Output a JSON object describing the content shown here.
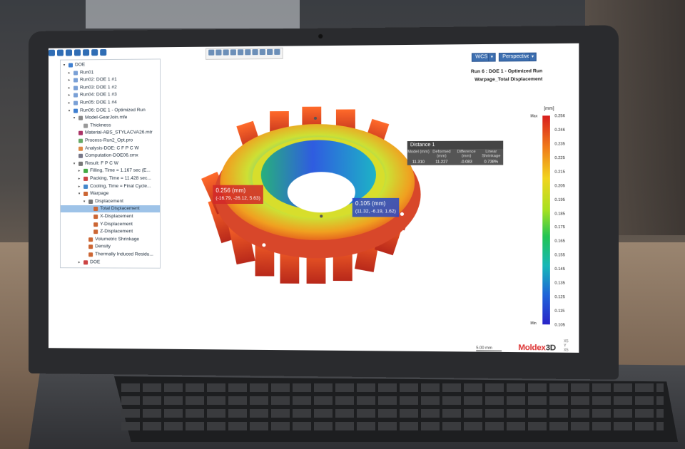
{
  "tree": {
    "nodes": [
      {
        "label": "DOE",
        "indent": 0,
        "toggle": "▾",
        "color": "#3f7fd0"
      },
      {
        "label": "Run01",
        "indent": 1,
        "toggle": "▸",
        "color": "#7aa0d6"
      },
      {
        "label": "Run02: DOE 1 #1",
        "indent": 1,
        "toggle": "▸",
        "color": "#7aa0d6"
      },
      {
        "label": "Run03: DOE 1 #2",
        "indent": 1,
        "toggle": "▸",
        "color": "#7aa0d6"
      },
      {
        "label": "Run04: DOE 1 #3",
        "indent": 1,
        "toggle": "▸",
        "color": "#7aa0d6"
      },
      {
        "label": "Run05: DOE 1 #4",
        "indent": 1,
        "toggle": "▸",
        "color": "#7aa0d6"
      },
      {
        "label": "Run06: DOE 1 - Optimized Run",
        "indent": 1,
        "toggle": "▾",
        "color": "#3f7fd0"
      },
      {
        "label": "Model-GearJoin.mfe",
        "indent": 2,
        "toggle": "▾",
        "color": "#888"
      },
      {
        "label": "Thickness",
        "indent": 3,
        "toggle": "",
        "color": "#999"
      },
      {
        "label": "Material-ABS_STYLACVA26.mtr",
        "indent": 2,
        "toggle": "",
        "color": "#a36"
      },
      {
        "label": "Process-Run2_Opt.pro",
        "indent": 2,
        "toggle": "",
        "color": "#6a6"
      },
      {
        "label": "Analysis-DOE: C F P C W",
        "indent": 2,
        "toggle": "",
        "color": "#d84"
      },
      {
        "label": "Computation-DOE06.cmx",
        "indent": 2,
        "toggle": "",
        "color": "#778"
      },
      {
        "label": "Result: F P C W",
        "indent": 2,
        "toggle": "▾",
        "color": "#777"
      },
      {
        "label": "Filling, Time = 1.167 sec (E...",
        "indent": 3,
        "toggle": "▸",
        "color": "#4a4"
      },
      {
        "label": "Packing, Time = 11.428 sec...",
        "indent": 3,
        "toggle": "▸",
        "color": "#c44"
      },
      {
        "label": "Cooling, Time = Final Cycle...",
        "indent": 3,
        "toggle": "▸",
        "color": "#48c"
      },
      {
        "label": "Warpage",
        "indent": 3,
        "toggle": "▾",
        "color": "#c63"
      },
      {
        "label": "Displacement",
        "indent": 4,
        "toggle": "▾",
        "color": "#777"
      },
      {
        "label": "Total Displacement",
        "indent": 5,
        "toggle": "",
        "color": "#c63",
        "selected": true
      },
      {
        "label": "X-Displacement",
        "indent": 5,
        "toggle": "",
        "color": "#c63"
      },
      {
        "label": "Y-Displacement",
        "indent": 5,
        "toggle": "",
        "color": "#c63"
      },
      {
        "label": "Z-Displacement",
        "indent": 5,
        "toggle": "",
        "color": "#c63"
      },
      {
        "label": "Volumetric Shrinkage",
        "indent": 4,
        "toggle": "",
        "color": "#c63"
      },
      {
        "label": "Density",
        "indent": 4,
        "toggle": "",
        "color": "#c63"
      },
      {
        "label": "Thermally Induced Residu...",
        "indent": 4,
        "toggle": "",
        "color": "#c63"
      },
      {
        "label": "DOE",
        "indent": 3,
        "toggle": "▸",
        "color": "#c44"
      }
    ]
  },
  "viewport": {
    "coord_system": "WCS",
    "projection": "Perspective",
    "title_line1": "Run 6 : DOE 1 - Optimized Run",
    "title_line2": "Warpage_Total Displacement"
  },
  "callouts": {
    "red": {
      "value": "0.256 (mm)",
      "coord": "(-16.79, -26.12, 5.63)"
    },
    "blue": {
      "value": "0.105 (mm)",
      "coord": "(11.32, -6.19, 1.62)"
    }
  },
  "distance": {
    "title": "Distance 1",
    "headers": [
      "Model (mm)",
      "Deformed (mm)",
      "Difference (mm)",
      "Linear Shrinkage"
    ],
    "values": [
      "11.310",
      "11.227",
      "-0.083",
      "0.738%"
    ]
  },
  "legend": {
    "unit": "[mm]",
    "max_label": "Max",
    "min_label": "Min",
    "ticks": [
      "0.256",
      "0.246",
      "0.235",
      "0.225",
      "0.215",
      "0.205",
      "0.195",
      "0.185",
      "0.175",
      "0.165",
      "0.155",
      "0.145",
      "0.135",
      "0.125",
      "0.115",
      "0.105"
    ]
  },
  "footer": {
    "scale": "5.00 mm",
    "brand_a": "Moldex",
    "brand_b": "3D",
    "triad": [
      "X5",
      "Y",
      "X5"
    ]
  }
}
